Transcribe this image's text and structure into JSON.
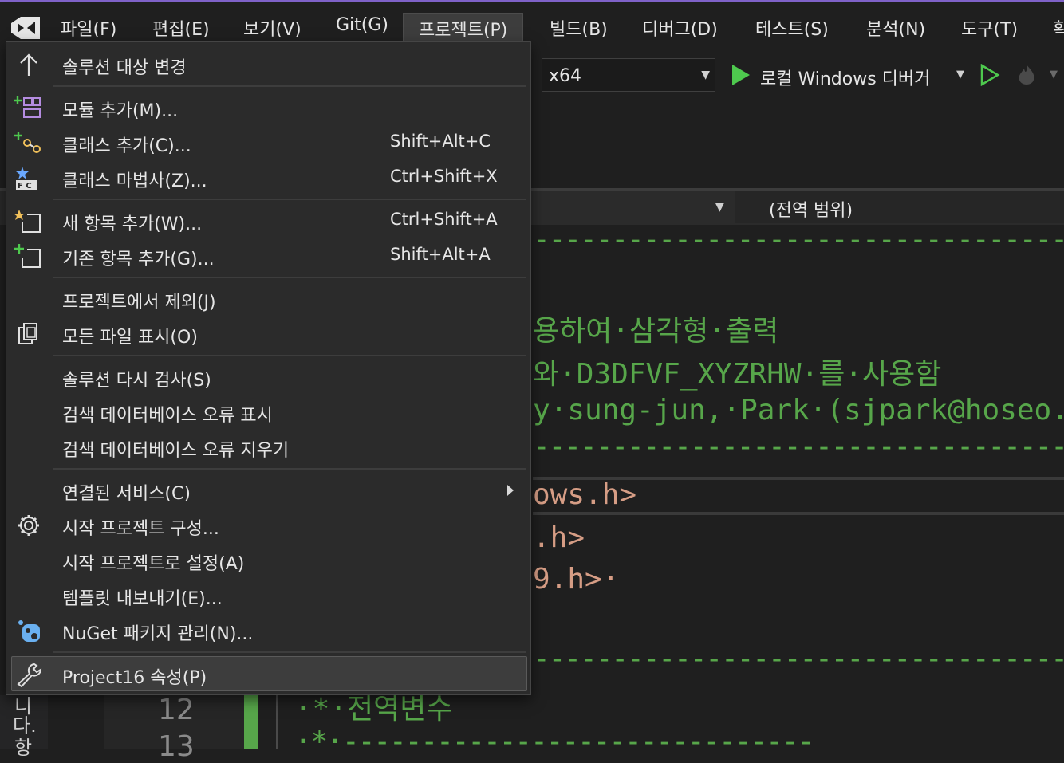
{
  "menubar": {
    "items": [
      "파일(F)",
      "편집(E)",
      "보기(V)",
      "Git(G)",
      "프로젝트(P)",
      "빌드(B)",
      "디버그(D)",
      "테스트(S)",
      "분석(N)",
      "도구(T)",
      "확"
    ],
    "active_index": 4
  },
  "toolbar": {
    "platform": "x64",
    "debugger_label": "로컬 Windows 디버거",
    "accent_green": "#4ec94e"
  },
  "editor": {
    "scope": "(전역 범위)",
    "lines": {
      "comment1": "용하여·삼각형·출력",
      "comment2": "와·D3DFVF_XYZRHW·를·사용함",
      "comment3": "y·sung-jun,·Park·(sjpark@hoseo.",
      "include1": "ows.h>",
      "include2": ".h>",
      "include3": "9.h>·",
      "global_comment": "·*·전역변수",
      "line_number": "12",
      "line_number_next": "13"
    },
    "left_text": [
      "니",
      "다.",
      "항"
    ]
  },
  "menu": {
    "items": [
      {
        "label": "솔루션 대상 변경",
        "shortcut": "",
        "icon": "arrow-up-icon"
      },
      {
        "label": "모듈 추가(M)...",
        "shortcut": "",
        "icon": "add-module-icon"
      },
      {
        "label": "클래스 추가(C)...",
        "shortcut": "Shift+Alt+C",
        "icon": "add-class-icon"
      },
      {
        "label": "클래스 마법사(Z)...",
        "shortcut": "Ctrl+Shift+X",
        "icon": "class-wizard-icon"
      },
      {
        "label": "새 항목 추가(W)...",
        "shortcut": "Ctrl+Shift+A",
        "icon": "new-item-icon"
      },
      {
        "label": "기존 항목 추가(G)...",
        "shortcut": "Shift+Alt+A",
        "icon": "existing-item-icon"
      },
      {
        "label": "프로젝트에서 제외(J)",
        "shortcut": "",
        "icon": ""
      },
      {
        "label": "모든 파일 표시(O)",
        "shortcut": "",
        "icon": "show-all-files-icon"
      },
      {
        "label": "솔루션 다시 검사(S)",
        "shortcut": "",
        "icon": ""
      },
      {
        "label": "검색 데이터베이스 오류 표시",
        "shortcut": "",
        "icon": ""
      },
      {
        "label": "검색 데이터베이스 오류 지우기",
        "shortcut": "",
        "icon": ""
      },
      {
        "label": "연결된 서비스(C)",
        "shortcut": "",
        "icon": ""
      },
      {
        "label": "시작 프로젝트 구성...",
        "shortcut": "",
        "icon": "gear-icon"
      },
      {
        "label": "시작 프로젝트로 설정(A)",
        "shortcut": "",
        "icon": ""
      },
      {
        "label": "템플릿 내보내기(E)...",
        "shortcut": "",
        "icon": ""
      },
      {
        "label": "NuGet 패키지 관리(N)...",
        "shortcut": "",
        "icon": "nuget-icon"
      },
      {
        "label": "Project16 속성(P)",
        "shortcut": "",
        "icon": "wrench-icon"
      }
    ],
    "selected_index": 16
  }
}
